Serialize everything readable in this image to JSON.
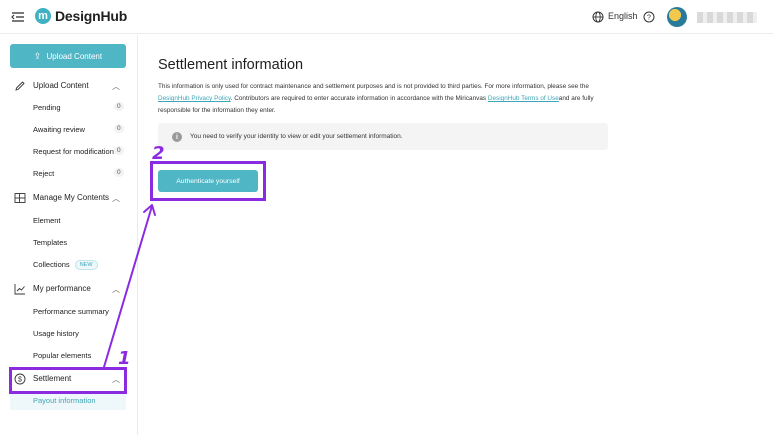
{
  "header": {
    "logo_letter": "m",
    "app_name": "DesignHub",
    "language": "English"
  },
  "sidebar": {
    "upload_button": "Upload Content",
    "sections": [
      {
        "label": "Upload Content",
        "items": [
          {
            "label": "Pending",
            "count": "0"
          },
          {
            "label": "Awaiting review",
            "count": "0"
          },
          {
            "label": "Request for modification",
            "count": "0"
          },
          {
            "label": "Reject",
            "count": "0"
          }
        ]
      },
      {
        "label": "Manage My Contents",
        "items": [
          {
            "label": "Element"
          },
          {
            "label": "Templates"
          },
          {
            "label": "Collections",
            "badge": "NEW"
          }
        ]
      },
      {
        "label": "My performance",
        "items": [
          {
            "label": "Performance summary"
          },
          {
            "label": "Usage history"
          },
          {
            "label": "Popular elements"
          }
        ]
      },
      {
        "label": "Settlement",
        "items": [
          {
            "label": "Payout information"
          }
        ]
      }
    ]
  },
  "main": {
    "title": "Settlement information",
    "desc_part1": "This information is only used for contract maintenance and settlement purposes and is not provided to third parties. For more information, please see the ",
    "privacy_link": "DesignHub Privacy Policy",
    "desc_part2": ". Contributors are required to enter accurate information in accordance with the Miricanvas ",
    "terms_link": "DesignHub Terms of Use",
    "desc_part3": "and are fully responsible for the information they enter.",
    "notice": "You need to verify your identity to view or edit your settlement information.",
    "auth_button": "Authenticate yourself"
  },
  "annotations": {
    "step1": "1",
    "step2": "2",
    "color": "#8a2be2"
  }
}
